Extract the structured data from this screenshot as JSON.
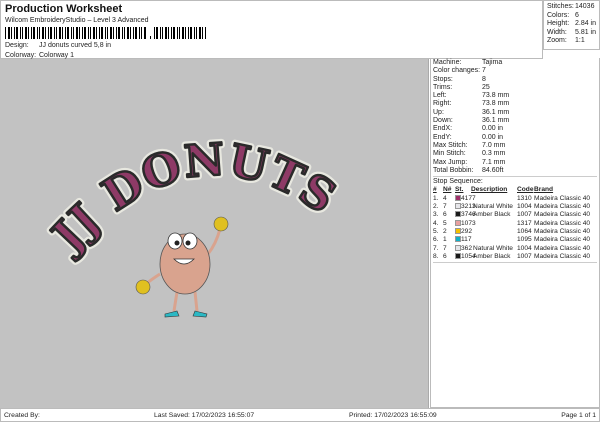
{
  "header": {
    "title": "Production Worksheet",
    "subtitle": "Wilcom EmbroideryStudio – Level 3 Advanced",
    "design_label": "Design:",
    "design_value": "JJ donuts curved 5,8 in",
    "colorway_label": "Colorway:",
    "colorway_value": "Colorway 1"
  },
  "stats": [
    {
      "k": "Stitches:",
      "v": "14036"
    },
    {
      "k": "Colors:",
      "v": "6"
    },
    {
      "k": "Height:",
      "v": "2.84 in"
    },
    {
      "k": "Width:",
      "v": "5.81 in"
    },
    {
      "k": "Zoom:",
      "v": "1:1"
    }
  ],
  "design": {
    "text": "JJ DONUTS",
    "colors": {
      "fill": "#8e3a66",
      "outline": "#2a2a2a",
      "border": "#e8e8e0",
      "donut": "#d9a38e",
      "hands": "#e0c020",
      "shoes": "#2bb8c4"
    }
  },
  "machine": [
    {
      "k": "Machine:",
      "v": "Tajima"
    },
    {
      "k": "Color changes:",
      "v": "7"
    },
    {
      "k": "Stops:",
      "v": "8"
    },
    {
      "k": "Trims:",
      "v": "25"
    },
    {
      "k": "Left:",
      "v": "73.8 mm"
    },
    {
      "k": "Right:",
      "v": "73.8 mm"
    },
    {
      "k": "Up:",
      "v": "36.1 mm"
    },
    {
      "k": "Down:",
      "v": "36.1 mm"
    },
    {
      "k": "EndX:",
      "v": "0.00 in"
    },
    {
      "k": "EndY:",
      "v": "0.00 in"
    },
    {
      "k": "Max Stitch:",
      "v": "7.0 mm"
    },
    {
      "k": "Min Stitch:",
      "v": "0.3 mm"
    },
    {
      "k": "Max Jump:",
      "v": "7.1 mm"
    },
    {
      "k": "Total Bobbin:",
      "v": "84.60ft"
    }
  ],
  "stop_sequence": {
    "label": "Stop Sequence:",
    "headers": [
      "#",
      "N#",
      "St.",
      "Description",
      "Code",
      "Brand"
    ],
    "rows": [
      {
        "n": "1.",
        "nn": "4",
        "color": "#a0306a",
        "st": "4177",
        "desc": "",
        "code": "1310",
        "brand": "Madeira Classic 40"
      },
      {
        "n": "2.",
        "nn": "7",
        "color": "#e6e6ea",
        "st": "3213",
        "desc": "Natural White",
        "code": "1004",
        "brand": "Madeira Classic 40"
      },
      {
        "n": "3.",
        "nn": "6",
        "color": "#1a1a1a",
        "st": "3746",
        "desc": "Amber Black",
        "code": "1007",
        "brand": "Madeira Classic 40"
      },
      {
        "n": "4.",
        "nn": "5",
        "color": "#e8a0a0",
        "st": "1073",
        "desc": "",
        "code": "1317",
        "brand": "Madeira Classic 40"
      },
      {
        "n": "5.",
        "nn": "2",
        "color": "#f5c000",
        "st": "292",
        "desc": "",
        "code": "1064",
        "brand": "Madeira Classic 40"
      },
      {
        "n": "6.",
        "nn": "1",
        "color": "#10b0c8",
        "st": "117",
        "desc": "",
        "code": "1095",
        "brand": "Madeira Classic 40"
      },
      {
        "n": "7.",
        "nn": "7",
        "color": "#e6e6ea",
        "st": "362",
        "desc": "Natural White",
        "code": "1004",
        "brand": "Madeira Classic 40"
      },
      {
        "n": "8.",
        "nn": "6",
        "color": "#1a1a1a",
        "st": "1054",
        "desc": "Amber Black",
        "code": "1007",
        "brand": "Madeira Classic 40"
      }
    ]
  },
  "footer": {
    "created": "Created By:",
    "saved": "Last Saved: 17/02/2023 16:55:07",
    "printed": "Printed: 17/02/2023 16:55:09",
    "page": "Page 1 of 1"
  }
}
